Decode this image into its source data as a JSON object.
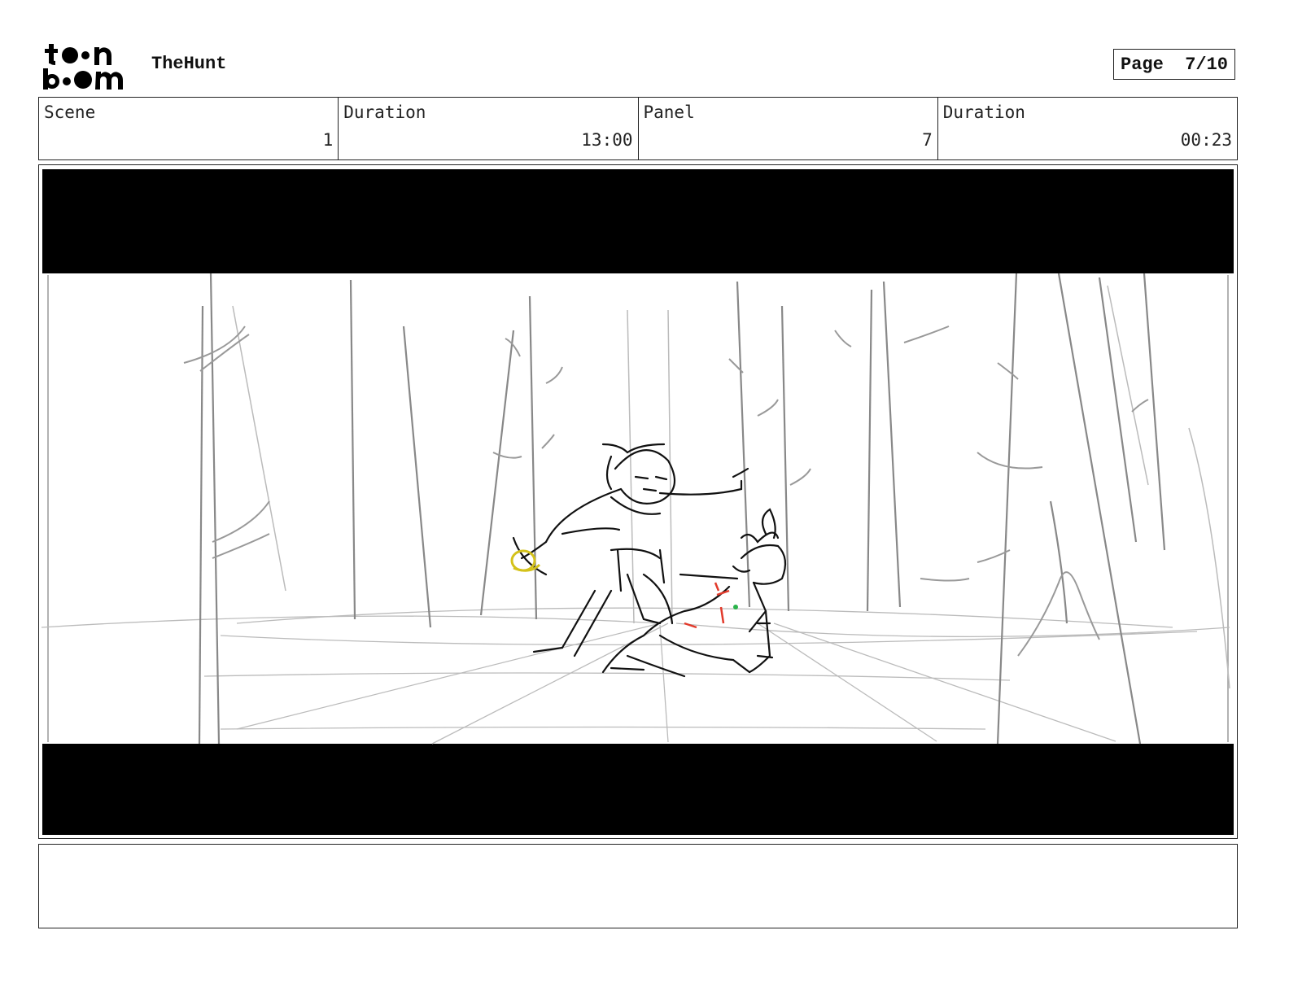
{
  "header": {
    "logo_text": "toon boom",
    "project_title": "TheHunt",
    "page_label": "Page",
    "page_value": "7/10"
  },
  "info": {
    "scene_label": "Scene",
    "scene_value": "1",
    "scene_duration_label": "Duration",
    "scene_duration_value": "13:00",
    "panel_label": "Panel",
    "panel_value": "7",
    "panel_duration_label": "Duration",
    "panel_duration_value": "00:23"
  },
  "notes": {
    "text": ""
  }
}
